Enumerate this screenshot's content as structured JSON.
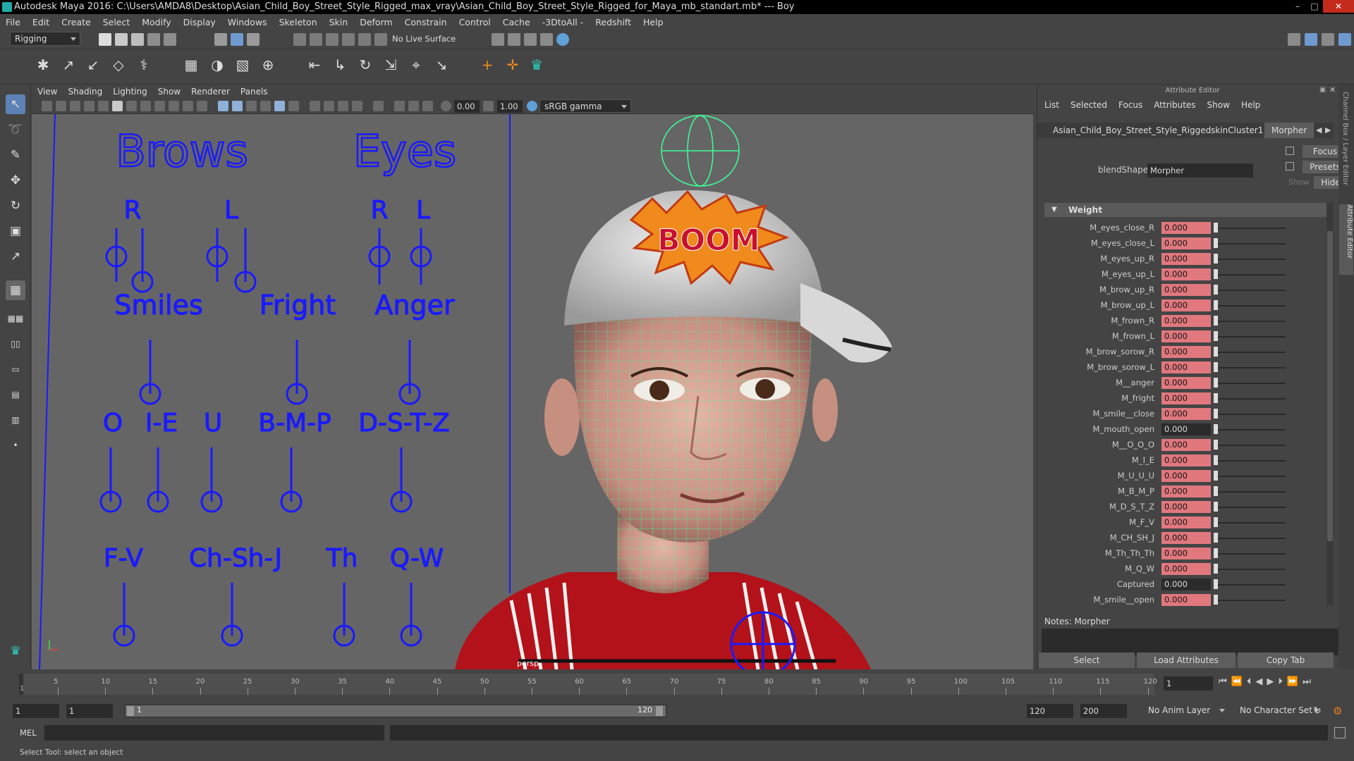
{
  "window": {
    "title": "Autodesk Maya 2016: C:\\Users\\AMDA8\\Desktop\\Asian_Child_Boy_Street_Style_Rigged_max_vray\\Asian_Child_Boy_Street_Style_Rigged_for_Maya_mb_standart.mb*  ---  Boy",
    "controls": [
      "minimize-icon",
      "maximize-icon",
      "close-icon"
    ]
  },
  "menubar": [
    "File",
    "Edit",
    "Create",
    "Select",
    "Modify",
    "Display",
    "Windows",
    "Skeleton",
    "Skin",
    "Deform",
    "Constrain",
    "Control",
    "Cache",
    "-3DtoAll -",
    "Redshift",
    "Help"
  ],
  "statusline": {
    "menuset": "Rigging",
    "live_surface": "No Live Surface"
  },
  "viewport": {
    "menu": [
      "View",
      "Shading",
      "Lighting",
      "Show",
      "Renderer",
      "Panels"
    ],
    "exposure": "0.00",
    "gamma": "1.00",
    "colorspace": "sRGB gamma",
    "camera_label": "persp",
    "controls": {
      "groups": [
        "Brows",
        "Eyes",
        "Smiles",
        "Fright",
        "Anger"
      ],
      "brows_r": "R",
      "brows_l": "L",
      "eyes_r": "R",
      "eyes_l": "L",
      "visemes": [
        "O",
        "I-E",
        "U",
        "B-M-P",
        "D-S-T-Z"
      ],
      "visemes2": [
        "F-V",
        "Ch-Sh-J",
        "Th",
        "Q-W"
      ]
    },
    "cap_text": "BOOM",
    "accent": "#1a1aff",
    "wire_color": "#3dff9a"
  },
  "attribute_editor": {
    "title": "Attribute Editor",
    "menu": [
      "List",
      "Selected",
      "Focus",
      "Attributes",
      "Show",
      "Help"
    ],
    "tabs": [
      "Asian_Child_Boy_Street_Style_Rigged",
      "skinCluster1",
      "Morpher"
    ],
    "active_tab": "Morpher",
    "focus_btn": "Focus",
    "presets_btn": "Presets",
    "show_label": "Show",
    "hide_btn": "Hide",
    "blendshape_label": "blendShape:",
    "blendshape_value": "Morpher",
    "section": "Weight",
    "weights": [
      {
        "name": "M_eyes_close_R",
        "value": "0.000",
        "keyed": true
      },
      {
        "name": "M_eyes_close_L",
        "value": "0.000",
        "keyed": true
      },
      {
        "name": "M_eyes_up_R",
        "value": "0.000",
        "keyed": true
      },
      {
        "name": "M_eyes_up_L",
        "value": "0.000",
        "keyed": true
      },
      {
        "name": "M_brow_up_R",
        "value": "0.000",
        "keyed": true
      },
      {
        "name": "M_brow_up_L",
        "value": "0.000",
        "keyed": true
      },
      {
        "name": "M_frown_R",
        "value": "0.000",
        "keyed": true
      },
      {
        "name": "M_frown_L",
        "value": "0.000",
        "keyed": true
      },
      {
        "name": "M_brow_sorow_R",
        "value": "0.000",
        "keyed": true
      },
      {
        "name": "M_brow_sorow_L",
        "value": "0.000",
        "keyed": true
      },
      {
        "name": "M__anger",
        "value": "0.000",
        "keyed": true
      },
      {
        "name": "M_fright",
        "value": "0.000",
        "keyed": true
      },
      {
        "name": "M_smile__close",
        "value": "0.000",
        "keyed": true
      },
      {
        "name": "M_mouth_open",
        "value": "0.000",
        "keyed": false
      },
      {
        "name": "M__O_O_O",
        "value": "0.000",
        "keyed": true
      },
      {
        "name": "M_I_E",
        "value": "0.000",
        "keyed": true
      },
      {
        "name": "M_U_U_U",
        "value": "0.000",
        "keyed": true
      },
      {
        "name": "M_B_M_P",
        "value": "0.000",
        "keyed": true
      },
      {
        "name": "M_D_S_T_Z",
        "value": "0.000",
        "keyed": true
      },
      {
        "name": "M_F_V",
        "value": "0.000",
        "keyed": true
      },
      {
        "name": "M_CH_SH_J",
        "value": "0.000",
        "keyed": true
      },
      {
        "name": "M_Th_Th_Th",
        "value": "0.000",
        "keyed": true
      },
      {
        "name": "M_Q_W",
        "value": "0.000",
        "keyed": true
      },
      {
        "name": "Captured",
        "value": "0.000",
        "keyed": false
      },
      {
        "name": "M_smile__open",
        "value": "0.000",
        "keyed": true
      }
    ],
    "notes_label": "Notes:  Morpher",
    "buttons": [
      "Select",
      "Load Attributes",
      "Copy Tab"
    ],
    "side_tabs": [
      "Channel Box / Layer Editor",
      "Attribute Editor"
    ],
    "keyed_color": "#e0787e"
  },
  "timeline": {
    "ticks": [
      "5",
      "10",
      "15",
      "20",
      "25",
      "30",
      "35",
      "40",
      "45",
      "50",
      "55",
      "60",
      "65",
      "70",
      "75",
      "80",
      "85",
      "90",
      "95",
      "100",
      "105",
      "110",
      "115",
      "120"
    ],
    "current_frame": "1",
    "first_tick": "1"
  },
  "range": {
    "start": "1",
    "playback_start": "1",
    "slider_start": "1",
    "slider_end": "120",
    "playback_end": "120",
    "end": "200",
    "anim_layer": "No Anim Layer",
    "character_set": "No Character Set"
  },
  "cmdline": {
    "lang": "MEL"
  },
  "help_line": "Select Tool: select an object"
}
